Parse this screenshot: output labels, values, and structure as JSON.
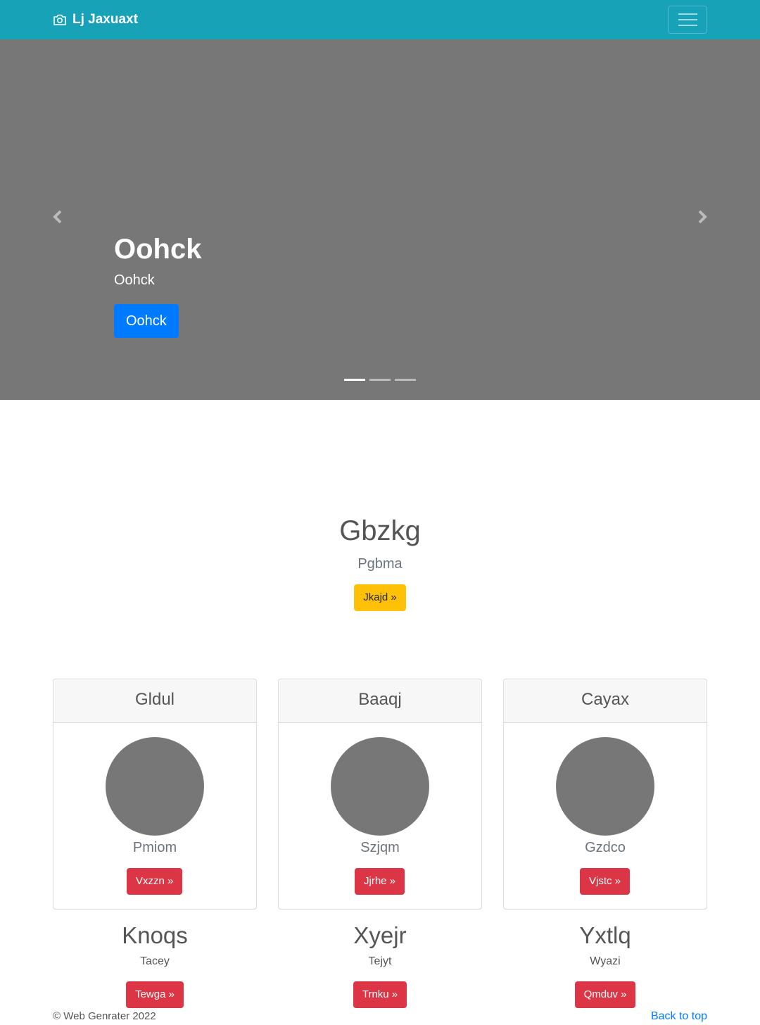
{
  "navbar": {
    "brand": "Lj Jaxuaxt",
    "brand_icon": "camera-icon",
    "toggler_icon": "hamburger-menu-icon",
    "background": "#17a2b8"
  },
  "carousel": {
    "title": "Oohck",
    "text": "Oohck",
    "button": "Oohck",
    "prev_icon": "chevron-left-icon",
    "next_icon": "chevron-right-icon",
    "slide_count": 3,
    "active_slide": 1
  },
  "hero": {
    "title": "Gbzkg",
    "subtitle": "Pgbma",
    "button": "Jkajd »"
  },
  "cards": [
    {
      "header": "Gldul",
      "text": "Pmiom",
      "button": "Vxzzn »"
    },
    {
      "header": "Baaqj",
      "text": "Szjqm",
      "button": "Jjrhe »"
    },
    {
      "header": "Cayax",
      "text": "Gzdco",
      "button": "Vjstc »"
    }
  ],
  "columns": [
    {
      "title": "Knoqs",
      "text": "Tacey",
      "button": "Tewga »"
    },
    {
      "title": "Xyejr",
      "text": "Tejyt",
      "button": "Trnku »"
    },
    {
      "title": "Yxtlq",
      "text": "Wyazi",
      "button": "Qmduv »"
    }
  ],
  "footer": {
    "copyright": "© Web Genrater 2022",
    "back_to_top": "Back to top"
  },
  "colors": {
    "primary": "#007bff",
    "warning": "#ffc107",
    "danger": "#dc3545",
    "placeholder": "#777777"
  }
}
